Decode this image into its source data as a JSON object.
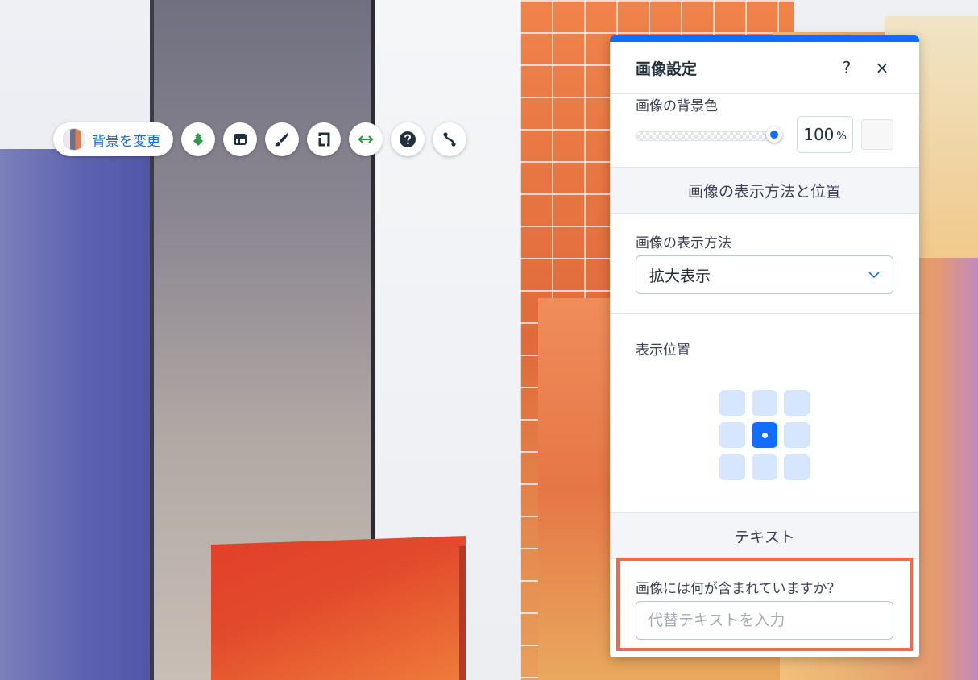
{
  "toolbar": {
    "change_background_label": "背景を変更",
    "buttons": [
      {
        "icon": "arrange-layers-icon",
        "color": "#2b9a4a"
      },
      {
        "icon": "layout-icon",
        "color": "#20303c"
      },
      {
        "icon": "design-brush-icon",
        "color": "#20303c"
      },
      {
        "icon": "crop-icon",
        "color": "#20303c"
      },
      {
        "icon": "stretch-arrows-icon",
        "color": "#2b9a4a"
      },
      {
        "icon": "help-icon",
        "color": "#20303c"
      },
      {
        "icon": "connect-icon",
        "color": "#20303c"
      }
    ]
  },
  "panel": {
    "title": "画像設定",
    "help_label": "?",
    "close_label": "×",
    "accent_color": "#116dff",
    "background_color": {
      "label": "画像の背景色",
      "opacity_value": "100",
      "opacity_unit": "%",
      "opacity_slider_fraction": 1.0
    },
    "display_section": {
      "header": "画像の表示方法と位置",
      "display_mode_label": "画像の表示方法",
      "display_mode_value": "拡大表示",
      "position_label": "表示位置",
      "position_grid_selected": "center"
    },
    "text_section": {
      "header": "テキスト",
      "alt_label": "画像には何が含まれていますか？",
      "alt_placeholder": "代替テキストを入力",
      "alt_value": "",
      "highlight_color": "#ef6a4d"
    }
  }
}
